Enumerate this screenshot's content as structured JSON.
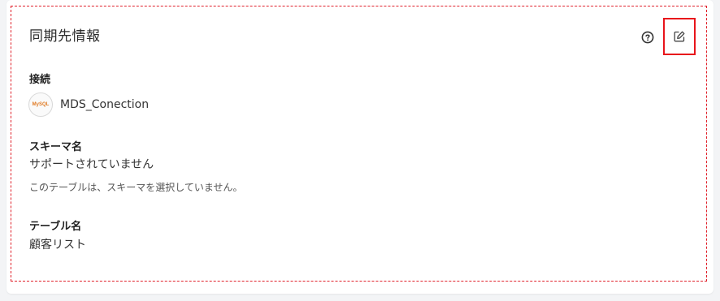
{
  "panel": {
    "title": "同期先情報",
    "help_icon": "help-circle-icon",
    "edit_icon": "edit-icon",
    "highlight_color": "#e8141b",
    "frame_color": "#e0202a"
  },
  "connection": {
    "label": "接続",
    "name": "MDS_Conection",
    "logo_text": "MySQL",
    "logo_icon": "mysql-logo"
  },
  "schema": {
    "label": "スキーマ名",
    "value": "サポートされていません",
    "note": "このテーブルは、スキーマを選択していません。"
  },
  "table": {
    "label": "テーブル名",
    "value": "顧客リスト"
  }
}
